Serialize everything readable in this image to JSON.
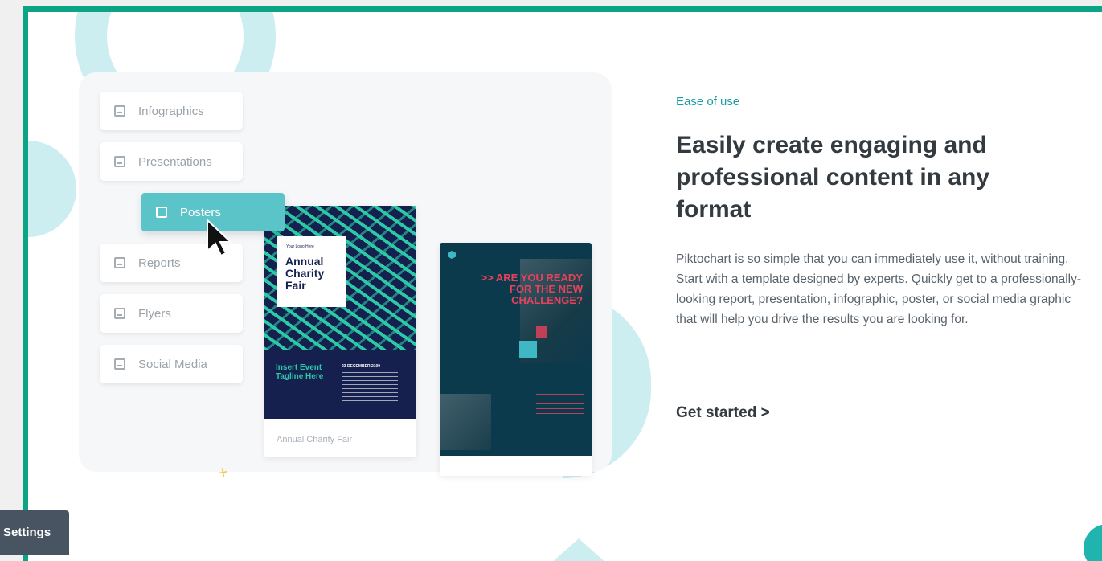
{
  "menu": {
    "items": [
      {
        "label": "Infographics",
        "icon": "bar-chart-icon"
      },
      {
        "label": "Presentations",
        "icon": "presentation-icon"
      },
      {
        "label": "Reports",
        "icon": "line-chart-icon"
      },
      {
        "label": "Flyers",
        "icon": "document-icon"
      },
      {
        "label": "Social Media",
        "icon": "social-chart-icon"
      }
    ],
    "active": {
      "label": "Posters",
      "icon": "image-icon"
    }
  },
  "cards": {
    "card1": {
      "logo": "Your Logo Here",
      "title": "Annual Charity Fair",
      "tagline": "Insert Event Tagline Here",
      "date": "23 DECEMBER 2100",
      "caption": "Annual Charity Fair"
    },
    "card2": {
      "title": ">> ARE YOU READY FOR THE NEW CHALLENGE?"
    }
  },
  "content": {
    "eyebrow": "Ease of use",
    "headline": "Easily create engaging and professional content in any format",
    "body": "Piktochart is so simple that you can immediately use it, without training. Start with a template designed by experts. Quickly get to a professionally-looking report, presentation, infographic, poster, or social media graphic that will help you drive the results you are looking for.",
    "cta": "Get started  >"
  },
  "settings": {
    "label": "Settings"
  },
  "colors": {
    "frame": "#0ba585",
    "accent": "#1a9fa0",
    "active_menu": "#5bc4c9",
    "decor": "#cdeef1"
  }
}
